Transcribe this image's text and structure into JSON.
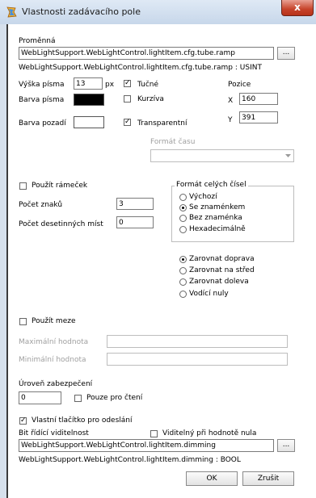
{
  "window": {
    "title": "Vlastnosti zadávacího pole",
    "close_glyph": "x"
  },
  "variable": {
    "label": "Proměnná",
    "value": "WebLightSupport.WebLightControl.lightItem.cfg.tube.ramp",
    "browse": "...",
    "type_info": "WebLightSupport.WebLightControl.lightItem.cfg.tube.ramp : USINT"
  },
  "font": {
    "height_label": "Výška písma",
    "height_value": "13",
    "height_unit": "px",
    "color_label": "Barva písma",
    "color": "#000000",
    "bg_label": "Barva pozadí",
    "bg_color": "#ffffff",
    "bold_label": "Tučné",
    "italic_label": "Kurzíva",
    "transparent_label": "Transparentní"
  },
  "position": {
    "label": "Pozice",
    "x_label": "X",
    "x_value": "160",
    "y_label": "Y",
    "y_value": "391"
  },
  "time_format": {
    "label": "Formát času",
    "value": ""
  },
  "frame": {
    "use_frame_label": "Použít rámeček",
    "chars_label": "Počet znaků",
    "chars_value": "3",
    "decimals_label": "Počet desetinných míst",
    "decimals_value": "0"
  },
  "int_format": {
    "label": "Formát celých čísel",
    "options": [
      "Výchozí",
      "Se znaménkem",
      "Bez znaménka",
      "Hexadecimálně"
    ],
    "selected": "Se znaménkem"
  },
  "alignment": {
    "options": [
      "Zarovnat doprava",
      "Zarovnat na střed",
      "Zarovnat doleva",
      "Vodící nuly"
    ],
    "selected": "Zarovnat doprava"
  },
  "limits": {
    "use_limits_label": "Použít meze",
    "max_label": "Maximální hodnota",
    "max_value": "",
    "min_label": "Minimální hodnota",
    "min_value": ""
  },
  "security": {
    "label": "Úroveň zabezpečení",
    "value": "0",
    "readonly_label": "Pouze pro čtení"
  },
  "send_button": {
    "custom_label": "Vlastní tlačítko pro odeslání",
    "visibility_bit_label": "Bit řídící viditelnost",
    "visible_zero_label": "Viditelný při hodnotě nula",
    "value": "WebLightSupport.WebLightControl.lightItem.dimming",
    "browse": "...",
    "type_info": "WebLightSupport.WebLightControl.lightItem.dimming : BOOL"
  },
  "buttons": {
    "ok": "OK",
    "cancel": "Zrušit"
  }
}
